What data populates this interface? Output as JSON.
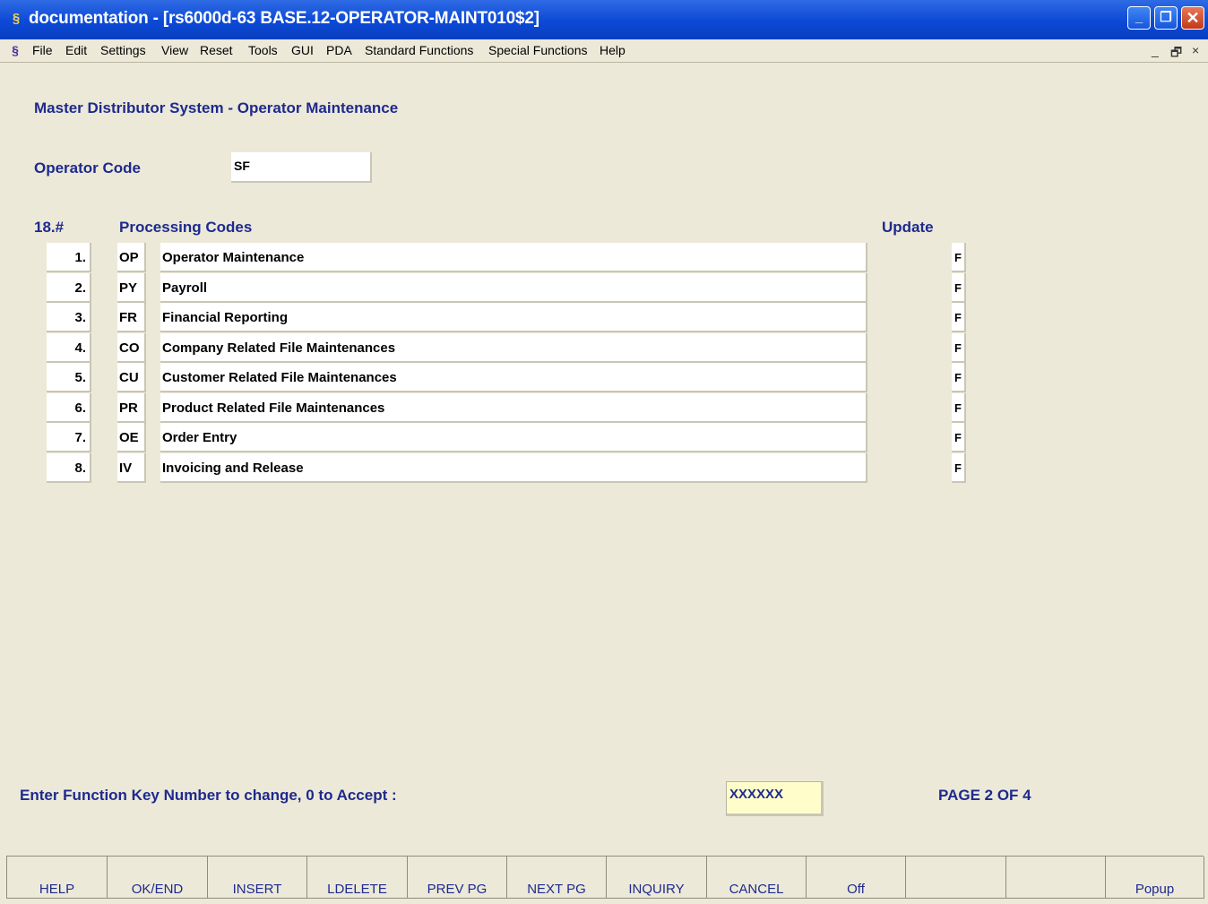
{
  "window": {
    "title": "documentation - [rs6000d-63 BASE.12-OPERATOR-MAINT010$2]",
    "app_icon": "app-icon"
  },
  "menu": {
    "items": [
      "File",
      "Edit",
      "Settings",
      "View",
      "Reset",
      "Tools",
      "GUI",
      "PDA",
      "Standard Functions",
      "Special Functions",
      "Help"
    ],
    "mdi_controls": [
      "_",
      "🗗",
      "×"
    ]
  },
  "screen": {
    "title": "Master Distributor System - Operator Maintenance",
    "operator_code_label": "Operator Code",
    "operator_code_value": "SF",
    "col_number": "18.#",
    "col_processing": "Processing Codes",
    "col_update": "Update",
    "rows": [
      {
        "num": "1.",
        "code": "OP",
        "desc": "Operator Maintenance",
        "update": "F"
      },
      {
        "num": "2.",
        "code": "PY",
        "desc": "Payroll",
        "update": "F"
      },
      {
        "num": "3.",
        "code": "FR",
        "desc": "Financial Reporting",
        "update": "F"
      },
      {
        "num": "4.",
        "code": "CO",
        "desc": "Company Related File Maintenances",
        "update": "F"
      },
      {
        "num": "5.",
        "code": "CU",
        "desc": "Customer Related File Maintenances",
        "update": "F"
      },
      {
        "num": "6.",
        "code": "PR",
        "desc": "Product Related File Maintenances",
        "update": "F"
      },
      {
        "num": "7.",
        "code": "OE",
        "desc": "Order Entry",
        "update": "F"
      },
      {
        "num": "8.",
        "code": "IV",
        "desc": "Invoicing and Release",
        "update": "F"
      }
    ],
    "prompt": "Enter Function Key Number to change, 0 to Accept :",
    "prompt_value": "XXXXXX",
    "page_info": "PAGE  2 OF  4"
  },
  "function_keys": [
    "HELP",
    "OK/END",
    "INSERT",
    "LDELETE",
    "PREV PG",
    "NEXT PG",
    "INQUIRY",
    "CANCEL",
    "Off",
    "",
    "",
    "Popup"
  ]
}
